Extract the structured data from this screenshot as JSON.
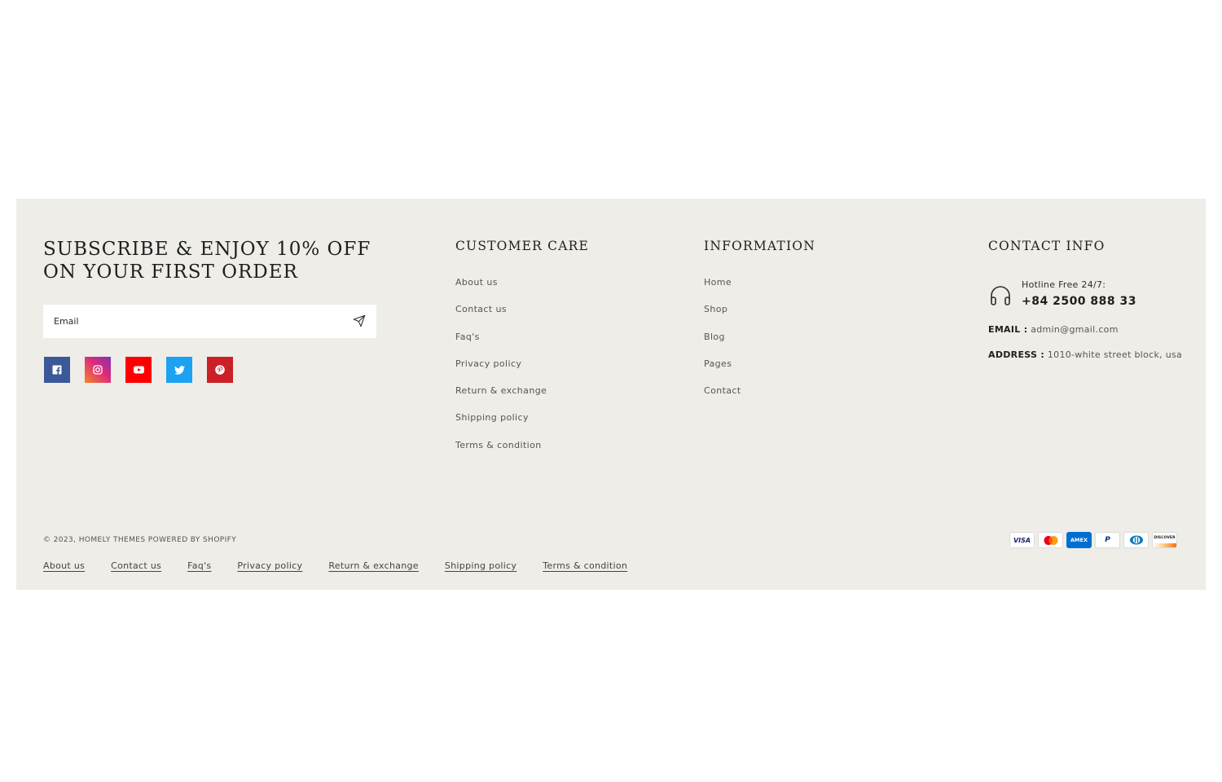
{
  "subscribe": {
    "title": "SUBSCRIBE & ENJOY 10% OFF ON YOUR FIRST ORDER",
    "email_placeholder": "Email",
    "socials": [
      {
        "name": "facebook-icon",
        "color": "#3b5998"
      },
      {
        "name": "instagram-icon",
        "color": "#e1306c"
      },
      {
        "name": "youtube-icon",
        "color": "#ff0000"
      },
      {
        "name": "twitter-icon",
        "color": "#1da1f2"
      },
      {
        "name": "pinterest-icon",
        "color": "#cb2027"
      }
    ]
  },
  "customer_care": {
    "title": "CUSTOMER CARE",
    "links": [
      "About us",
      "Contact us",
      "Faq's",
      "Privacy policy",
      "Return & exchange",
      "Shipping policy",
      "Terms & condition"
    ]
  },
  "information": {
    "title": "INFORMATION",
    "links": [
      "Home",
      "Shop",
      "Blog",
      "Pages",
      "Contact"
    ]
  },
  "contact": {
    "title": "CONTACT INFO",
    "hotline_label": "Hotline Free 24/7:",
    "phone": "+84 2500 888 33",
    "email_label": "EMAIL :",
    "email": "admin@gmail.com",
    "address_label": "ADDRESS :",
    "address": "1010-white street block, usa"
  },
  "bottom": {
    "copyright_prefix": "© 2023,",
    "brand": "HOMELY THEMES",
    "powered": "POWERED BY SHOPIFY",
    "policy_links": [
      "About us",
      "Contact us",
      "Faq's",
      "Privacy policy",
      "Return & exchange",
      "Shipping policy",
      "Terms & condition"
    ],
    "payments": [
      "visa",
      "mastercard",
      "american-express",
      "paypal",
      "diners-club",
      "discover"
    ],
    "payment_labels": {
      "visa": "VISA",
      "amex": "AMEX",
      "paypal": "P",
      "discover": "DISCOVER"
    }
  },
  "colors": {
    "footer_bg": "#eeede8",
    "heading": "#1f1f1f",
    "link": "#555555"
  }
}
